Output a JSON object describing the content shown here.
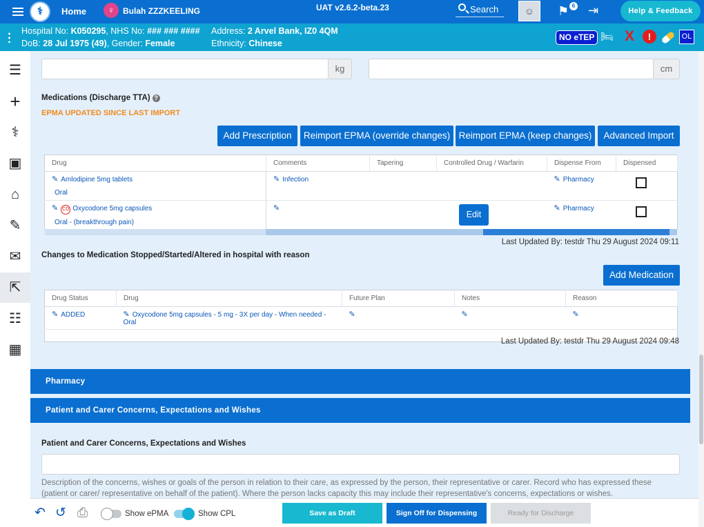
{
  "topbar": {
    "logo_text": "⚕",
    "home_label": "Home",
    "patient_name": "Bulah ZZZKEELING",
    "env_version": "UAT v2.6.2-beta.23",
    "search_label": "Search",
    "notification_count": "6",
    "help_label": "Help & Feedback"
  },
  "banner": {
    "hospital_label": "Hospital No:",
    "hospital_no": "K050295",
    "nhs_label": "NHS No:",
    "nhs_no": "### ### ####",
    "dob_label": "DoB:",
    "dob": "28 Jul 1975 (49)",
    "gender_label": "Gender:",
    "gender": "Female",
    "address_label": "Address:",
    "address": "2 Arvel Bank, IZ0 4QM",
    "ethnicity_label": "Ethnicity:",
    "ethnicity": "Chinese",
    "no_etep": "NO eTEP",
    "x_mark": "X",
    "alert_mark": "!",
    "ol_label": "OL"
  },
  "measurements": {
    "weight_unit": "kg",
    "height_unit": "cm"
  },
  "medications": {
    "title": "Medications (Discharge TTA)",
    "warning": "EPMA UPDATED SINCE LAST IMPORT",
    "buttons": {
      "add": "Add Prescription",
      "reimport_override": "Reimport EPMA (override changes)",
      "reimport_keep": "Reimport EPMA (keep changes)",
      "advanced": "Advanced Import"
    },
    "columns": [
      "Drug",
      "Comments",
      "Tapering",
      "Controlled Drug / Warfarin",
      "Dispense From",
      "Dispensed"
    ],
    "rows": [
      {
        "drug": "Amlodipine 5mg tablets",
        "route": "Oral",
        "comment": "Infection",
        "dispense_from": "Pharmacy"
      },
      {
        "cd_label": "CD",
        "drug": "Oxycodone 5mg capsules",
        "route": "Oral - (breakthrough pain)",
        "comment": "",
        "edit_label": "Edit",
        "dispense_from": "Pharmacy"
      }
    ],
    "last_updated": "Last Updated By: testdr Thu 29 August 2024 09:11"
  },
  "changes": {
    "title": "Changes to Medication Stopped/Started/Altered in hospital with reason",
    "add_button": "Add Medication",
    "columns": [
      "Drug Status",
      "Drug",
      "Future Plan",
      "Notes",
      "Reason"
    ],
    "rows": [
      {
        "status": "ADDED",
        "drug": "Oxycodone 5mg capsules - 5 mg - 3X per day - When needed - Oral"
      }
    ],
    "last_updated": "Last Updated By: testdr Thu 29 August 2024 09:48"
  },
  "sections": {
    "pharmacy": "Pharmacy",
    "concerns": "Patient and Carer Concerns, Expectations and Wishes"
  },
  "concerns": {
    "label": "Patient and Carer Concerns, Expectations and Wishes",
    "description": "Description of the concerns, wishes or goals of the person in relation to their care, as expressed by the person, their representative or carer. Record who has expressed these (patient or carer/ representative on behalf of the patient). Where the person lacks capacity this may include their representative's concerns, expectations or wishes."
  },
  "footer": {
    "show_epma": "Show ePMA",
    "show_cpl": "Show CPL",
    "save_draft": "Save as Draft",
    "sign_off": "Sign Off for Dispensing",
    "ready": "Ready for Discharge"
  },
  "colors": {
    "primary": "#0a6fd0",
    "banner": "#0fa3d1",
    "accent": "#17b8d0",
    "warning": "#f28a1d",
    "alert": "#e31d1d",
    "panel_bg": "#e3f0fb"
  }
}
